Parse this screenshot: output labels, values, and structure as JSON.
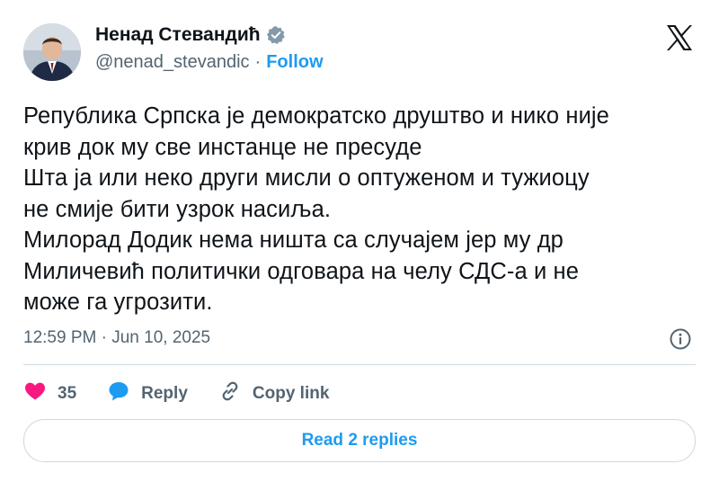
{
  "author": {
    "name": "Ненад Стевандић",
    "handle": "@nenad_stevandic",
    "separator": "·",
    "follow_label": "Follow"
  },
  "tweet": {
    "text": "Република Српска је демократско друштво и нико није\nкрив док му све инстанце не пресуде\nШта ја или неко други мисли о оптуженом и тужиоцу\nне смије бити узрок насиља.\nМилорад Додик нема ништа са случајем јер му  др\nМиличевић политички одговара на челу СДС-а и не\nможе га угрозити.",
    "time": "12:59 PM · Jun 10, 2025"
  },
  "actions": {
    "likes": "35",
    "reply_label": "Reply",
    "copy_label": "Copy link"
  },
  "replies_button": "Read 2 replies",
  "colors": {
    "accent": "#1d9bf0",
    "like": "#f91880",
    "muted": "#536471",
    "text": "#0f1419"
  },
  "icons": [
    "verified-badge-icon",
    "x-logo-icon",
    "info-icon",
    "heart-icon",
    "reply-bubble-icon",
    "link-icon"
  ]
}
